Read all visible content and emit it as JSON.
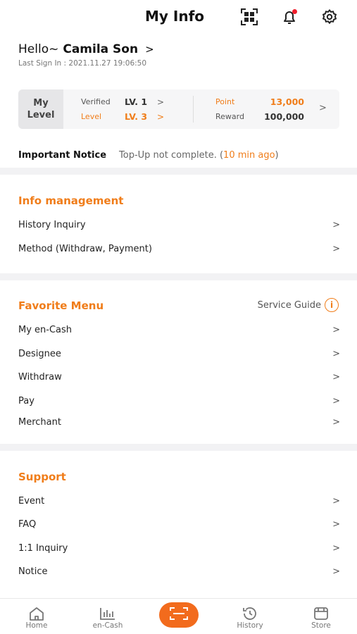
{
  "header": {
    "title": "My Info"
  },
  "profile": {
    "greeting": "Hello~",
    "name": "Camila Son",
    "last_sign_in": "Last Sign In : 2021.11.27 19:06:50"
  },
  "level_card": {
    "my_level_line1": "My",
    "my_level_line2": "Level",
    "verified_label": "Verified",
    "verified_value": "LV. 1",
    "level_label": "Level",
    "level_value": "LV. 3",
    "point_label": "Point",
    "point_value": "13,000",
    "reward_label": "Reward",
    "reward_value": "100,000"
  },
  "notice": {
    "title": "Important Notice",
    "message": "Top-Up not complete. (",
    "ago": "10 min ago",
    "close": ")"
  },
  "info_management": {
    "title": "Info management",
    "items": [
      "History Inquiry",
      "Method (Withdraw, Payment)"
    ]
  },
  "favorite_menu": {
    "title": "Favorite Menu",
    "service_guide": "Service Guide",
    "items": [
      "My en-Cash",
      "Designee",
      "Withdraw",
      "Pay",
      "Merchant"
    ]
  },
  "support": {
    "title": "Support",
    "items": [
      "Event",
      "FAQ",
      "1:1 Inquiry",
      "Notice"
    ]
  },
  "tabbar": {
    "home": "Home",
    "encash": "en-Cash",
    "history": "History",
    "store": "Store"
  },
  "colors": {
    "accent": "#f07d1a",
    "scan_button": "#f26b1d",
    "alert_dot": "#f01e2c"
  },
  "icons": [
    "qr-code-icon",
    "bell-icon",
    "gear-icon",
    "home-icon",
    "chart-icon",
    "scan-icon",
    "history-icon",
    "store-icon"
  ]
}
